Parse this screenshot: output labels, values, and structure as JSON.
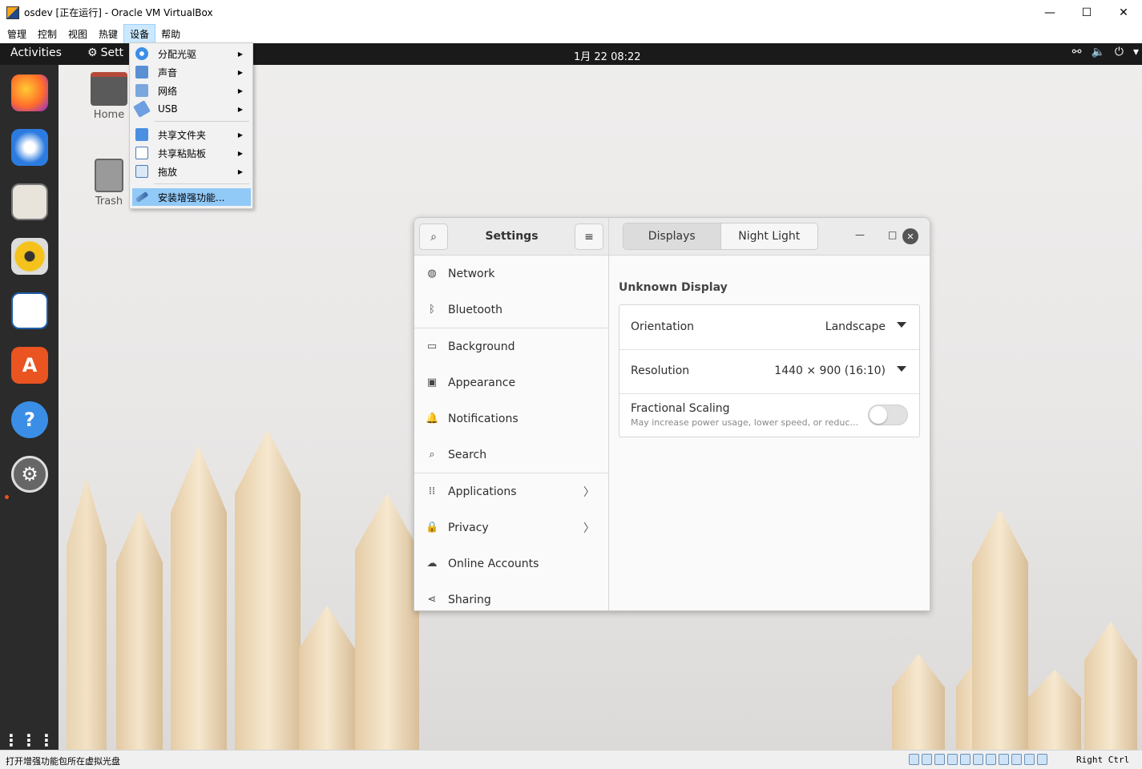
{
  "window": {
    "title": "osdev [正在运行] - Oracle VM VirtualBox",
    "minimize": "—",
    "maximize": "☐",
    "close": "✕"
  },
  "menubar": [
    "管理",
    "控制",
    "视图",
    "热键",
    "设备",
    "帮助"
  ],
  "devices_menu": {
    "items": [
      {
        "label": "分配光驱",
        "icon": "optical-drive-icon",
        "submenu": true
      },
      {
        "label": "声音",
        "icon": "audio-icon",
        "submenu": true
      },
      {
        "label": "网络",
        "icon": "network-icon",
        "submenu": true
      },
      {
        "label": "USB",
        "icon": "usb-icon",
        "submenu": true
      },
      {
        "label": "共享文件夹",
        "icon": "shared-folder-icon",
        "submenu": true
      },
      {
        "label": "共享粘贴板",
        "icon": "clipboard-icon",
        "submenu": true
      },
      {
        "label": "拖放",
        "icon": "drag-drop-icon",
        "submenu": true
      },
      {
        "label": "安装增强功能...",
        "icon": "guest-additions-icon",
        "submenu": false,
        "highlighted": true
      }
    ],
    "arrow": "▶"
  },
  "topbar": {
    "activities": "Activities",
    "app": "Sett",
    "clock": "1月 22  08:22",
    "tray": [
      "⚯",
      "🔈",
      "⏻",
      "▾"
    ]
  },
  "desktop": {
    "home": "Home",
    "trash": "Trash"
  },
  "settings": {
    "title": "Settings",
    "search_icon": "⌕",
    "menu_icon": "≡",
    "tabs": [
      "Displays",
      "Night Light"
    ],
    "min": "—",
    "max": "□",
    "close": "✕",
    "sidebar": [
      {
        "label": "Network",
        "icon": "◍"
      },
      {
        "label": "Bluetooth",
        "icon": "ᛒ"
      },
      {
        "label": "Background",
        "icon": "▭"
      },
      {
        "label": "Appearance",
        "icon": "▣"
      },
      {
        "label": "Notifications",
        "icon": "🔔"
      },
      {
        "label": "Search",
        "icon": "⌕"
      },
      {
        "label": "Applications",
        "icon": "⁞⁞",
        "chevron": "〉"
      },
      {
        "label": "Privacy",
        "icon": "🔒",
        "chevron": "〉"
      },
      {
        "label": "Online Accounts",
        "icon": "☁"
      },
      {
        "label": "Sharing",
        "icon": "⋖"
      }
    ],
    "display_name": "Unknown Display",
    "orientation": {
      "label": "Orientation",
      "value": "Landscape"
    },
    "resolution": {
      "label": "Resolution",
      "value": "1440 × 900 (16:10)"
    },
    "fractional": {
      "label": "Fractional Scaling",
      "sub": "May increase power usage, lower speed, or reduc…",
      "enabled": false
    }
  },
  "statusbar": {
    "text": "打开增强功能包所在虚拟光盘",
    "hostkey": "Right Ctrl"
  },
  "colors": {
    "accent": "#91c9f7",
    "topbar": "#1a1a1a",
    "dock": "#2b2b2b"
  }
}
